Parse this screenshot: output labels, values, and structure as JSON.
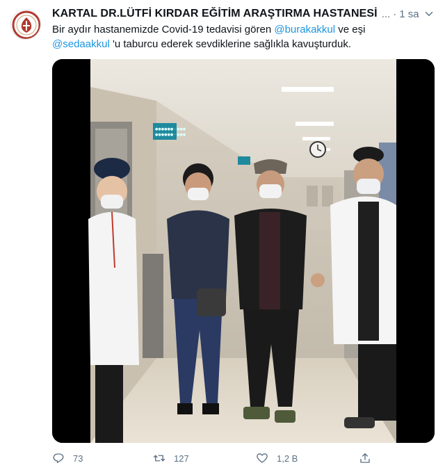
{
  "tweet": {
    "author_name": "KARTAL DR.LÜTFİ KIRDAR EĞİTİM ARAŞTIRMA HASTANESİ",
    "name_ellipsis": "...",
    "separator": "·",
    "time": "1 sa",
    "text_part1": "Bir aydır hastanemizde Covid-19 tedavisi gören ",
    "mention1": "@burakakkul",
    "text_part2": " ve eşi",
    "mention2": "@sedaakkul",
    "text_part3": " 'u taburcu ederek sevdiklerine sağlıkla kavuşturduk.",
    "hallway_sign_lines": [
      "●●●●●● - ●●●",
      "●●●●●● - ●●●"
    ]
  },
  "actions": {
    "reply_count": "73",
    "retweet_count": "127",
    "like_count": "1,2 B"
  },
  "icons": {
    "reply": "reply-icon",
    "retweet": "retweet-icon",
    "like": "heart-icon",
    "share": "share-icon",
    "more": "chevron-down-icon"
  },
  "colors": {
    "accent": "#1b95e0",
    "secondary_text": "#5b7083",
    "avatar_red": "#c0392b"
  }
}
